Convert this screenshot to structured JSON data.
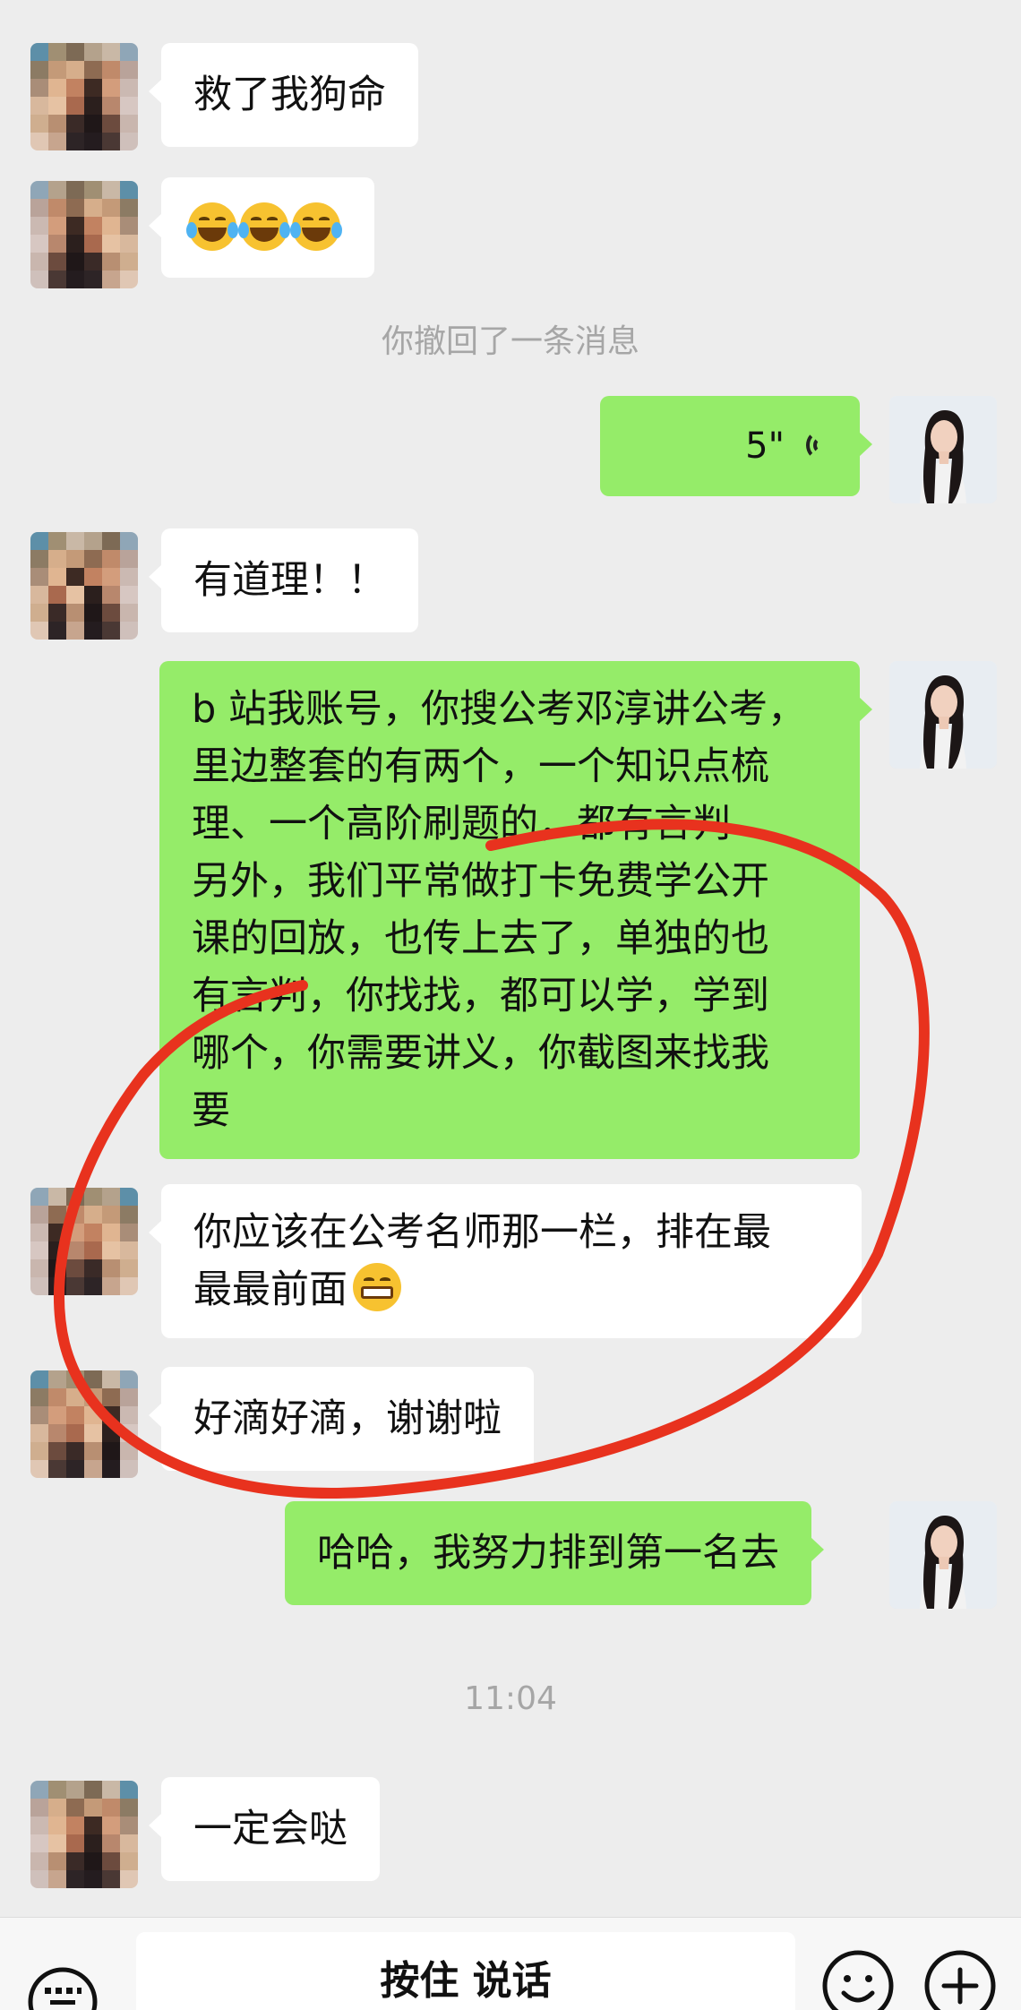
{
  "messages": [
    {
      "side": "in",
      "text": "救了我狗命"
    },
    {
      "side": "in",
      "emoji_count": 3,
      "emoji": "laughing-tears"
    },
    {
      "side": "system",
      "text": "你撤回了一条消息"
    },
    {
      "side": "out",
      "type": "voice",
      "duration": "5\""
    },
    {
      "side": "in",
      "text": "有道理！！"
    },
    {
      "side": "out",
      "lines": [
        "b 站我账号，你搜公考邓淳讲公考，",
        "里边整套的有两个，一个知识点梳",
        "理、一个高阶刷题的，都有言判",
        "另外，我们平常做打卡免费学公开",
        "课的回放，也传上去了，单独的也",
        "有言判，你找找，都可以学，学到",
        "哪个，你需要讲义，你截图来找我",
        "要"
      ]
    },
    {
      "side": "in",
      "lines": [
        "你应该在公考名师那一栏，排在最",
        "最最前面"
      ],
      "emoji": "grinning"
    },
    {
      "side": "in",
      "text": "好滴好滴，谢谢啦"
    },
    {
      "side": "out",
      "text": "哈哈，我努力排到第一名去"
    },
    {
      "side": "system",
      "text": "11:04"
    },
    {
      "side": "in",
      "text": "一定会哒"
    }
  ],
  "input_bar": {
    "hold_to_talk": "按住 说话",
    "icons": [
      "keyboard-icon",
      "emoji-icon",
      "plus-icon"
    ]
  },
  "colors": {
    "background": "#ededed",
    "incoming_bubble": "#ffffff",
    "outgoing_bubble": "#95ec69",
    "annotation": "#e8321e"
  }
}
